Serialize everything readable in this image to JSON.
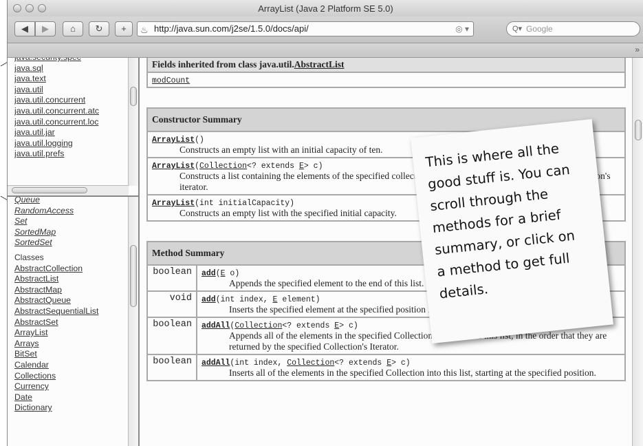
{
  "window": {
    "title": "ArrayList (Java 2 Platform SE 5.0)"
  },
  "toolbar": {
    "back_icon": "back-arrow-icon",
    "forward_icon": "forward-arrow-icon",
    "home_icon": "home-icon",
    "reload_icon": "reload-icon",
    "add_icon": "plus-icon",
    "url": "http://java.sun.com/j2se/1.5.0/docs/api/",
    "search_placeholder": "Google"
  },
  "packages": [
    "java.security.spec",
    "java.sql",
    "java.text",
    "java.util",
    "java.util.concurrent",
    "java.util.concurrent.atc",
    "java.util.concurrent.loc",
    "java.util.jar",
    "java.util.logging",
    "java.util.prefs"
  ],
  "interfaces_tail": [
    "Queue",
    "RandomAccess",
    "Set",
    "SortedMap",
    "SortedSet"
  ],
  "classes_heading": "Classes",
  "classes": [
    "AbstractCollection",
    "AbstractList",
    "AbstractMap",
    "AbstractQueue",
    "AbstractSequentialList",
    "AbstractSet",
    "ArrayList",
    "Arrays",
    "BitSet",
    "Calendar",
    "Collections",
    "Currency",
    "Date",
    "Dictionary"
  ],
  "fields_inherited": {
    "heading_prefix": "Fields inherited from class java.util.",
    "heading_link": "AbstractList",
    "field": "modCount"
  },
  "constructor_summary": {
    "heading": "Constructor Summary",
    "rows": [
      {
        "name": "ArrayList",
        "sig_html": "()",
        "desc": "Constructs an empty list with an initial capacity of ten."
      },
      {
        "name": "ArrayList",
        "sig_html": "(Collection<? extends E> c)",
        "desc": "Constructs a list containing the elements of the specified collection, in the order they are returned by the collection's iterator."
      },
      {
        "name": "ArrayList",
        "sig_html": "(int initialCapacity)",
        "desc": "Constructs an empty list with the specified initial capacity."
      }
    ]
  },
  "method_summary": {
    "heading": "Method Summary",
    "rows": [
      {
        "ret": "boolean",
        "name": "add",
        "sig": "(E o)",
        "desc": "Appends the specified element to the end of this list."
      },
      {
        "ret": "void",
        "name": "add",
        "sig": "(int index, E element)",
        "desc": "Inserts the specified element at the specified position in this list."
      },
      {
        "ret": "boolean",
        "name": "addAll",
        "sig": "(Collection<? extends E> c)",
        "desc": "Appends all of the elements in the specified Collection to the end of this list, in the order that they are returned by the specified Collection's Iterator."
      },
      {
        "ret": "boolean",
        "name": "addAll",
        "sig": "(int index, Collection<? extends E> c)",
        "desc": "Inserts all of the elements in the specified Collection into this list, starting at the specified position."
      }
    ]
  },
  "note": {
    "text": "This is where all the\ngood stuff is. You can\nscroll through the\nmethods for a brief\nsummary, or click on\na method to get full\ndetails."
  }
}
